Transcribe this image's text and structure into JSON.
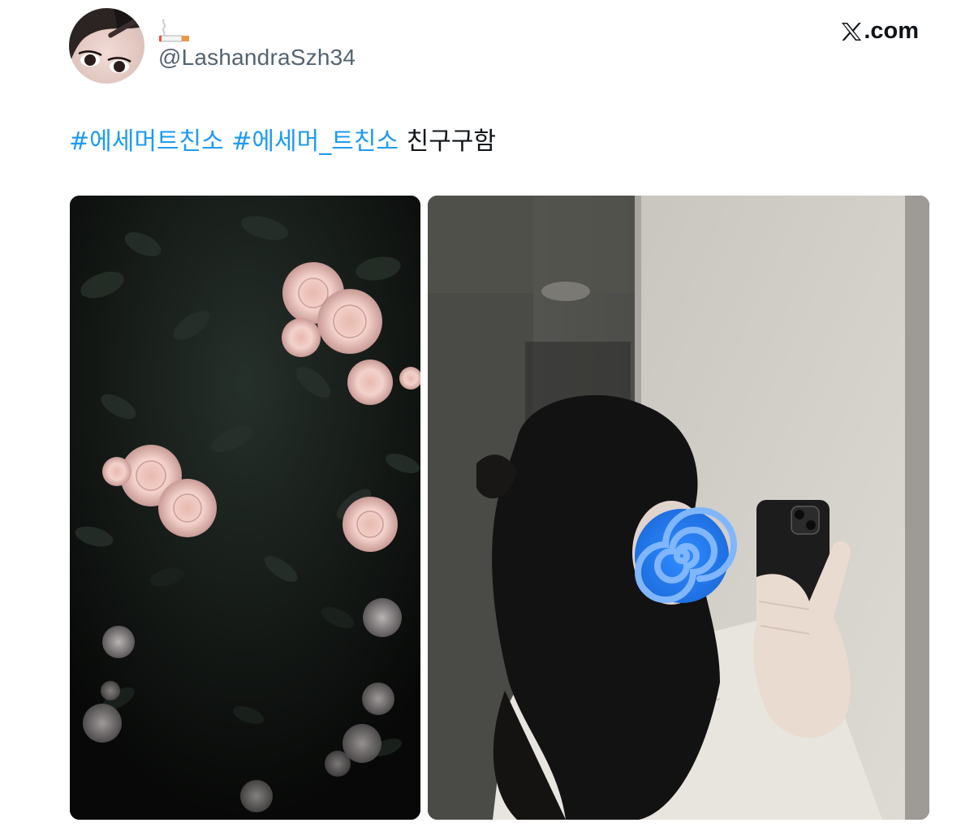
{
  "tweet": {
    "display_name_emoji": "🚬",
    "handle": "@LashandraSzh34",
    "brand_label": ".com",
    "text": {
      "hashtags": [
        "#에세머트친소",
        "#에세머_트친소"
      ],
      "body": "친구구함"
    }
  },
  "icons": {
    "brand_logo": "x-logo-icon",
    "name_emoji": "cigarette-icon"
  },
  "colors": {
    "hashtag": "#1d9bf0",
    "handle": "#536471",
    "text": "#0f1419",
    "spiral_sticker": "#2f8cff"
  }
}
